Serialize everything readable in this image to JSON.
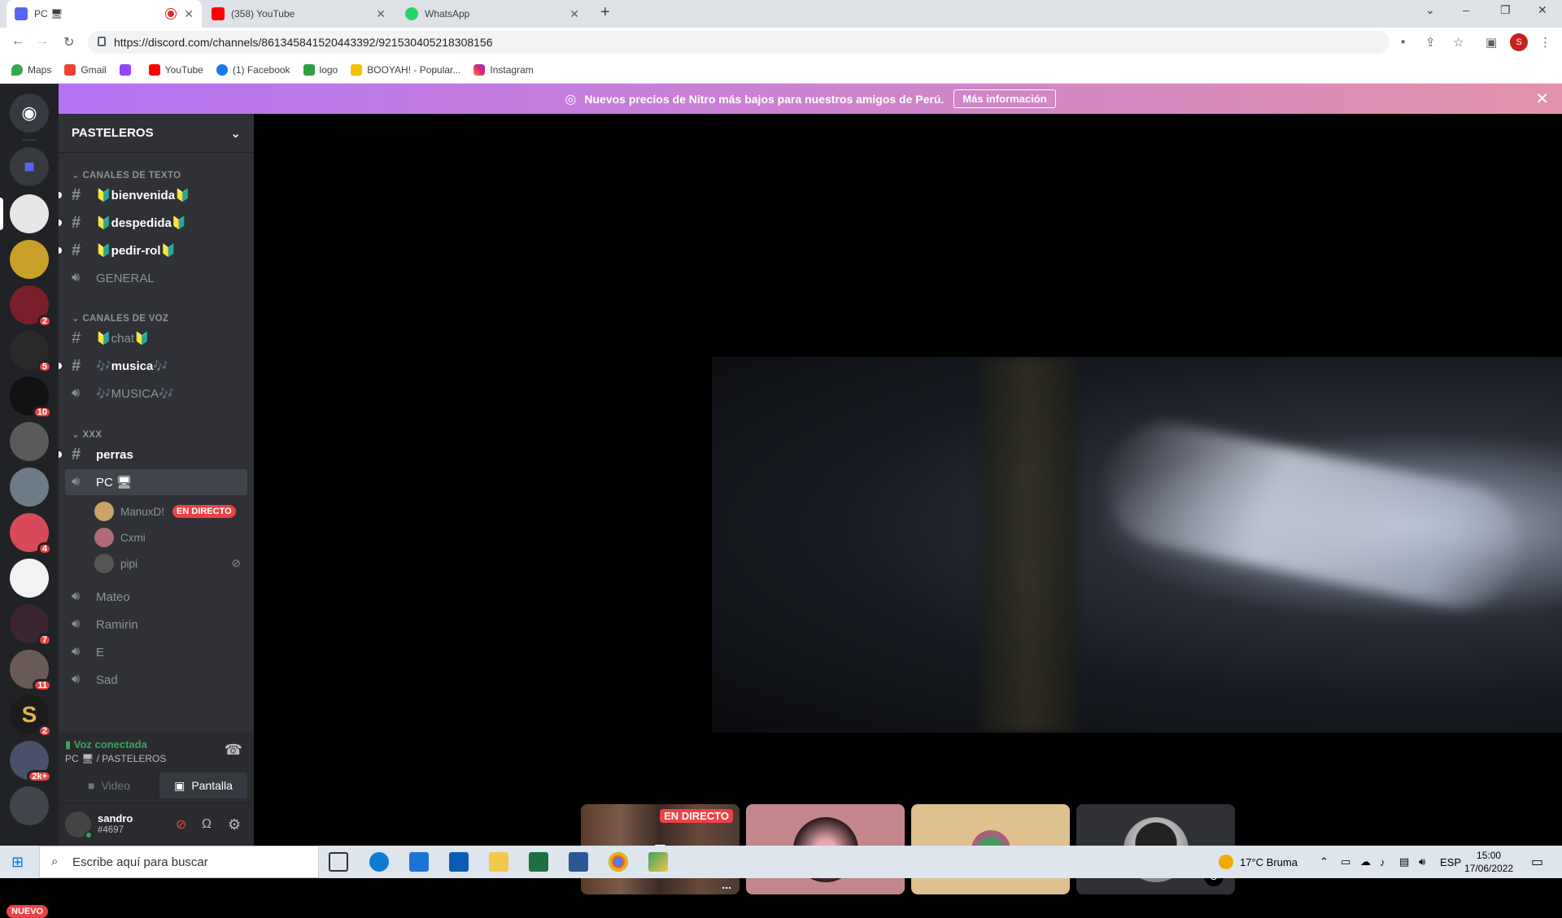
{
  "browser": {
    "tabs": [
      {
        "title": "PC 🖥",
        "active": true
      },
      {
        "title": "(358) YouTube"
      },
      {
        "title": "WhatsApp"
      }
    ],
    "new_tab": "+",
    "url": "https://discord.com/channels/861345841520443392/921530405218308156",
    "profile_initial": "S",
    "bookmarks": [
      "Maps",
      "Gmail",
      "",
      "YouTube",
      "(1) Facebook",
      "logo",
      "BOOYAH! - Popular...",
      "Instagram"
    ],
    "window_controls": [
      "⌄",
      "–",
      "❐",
      "✕"
    ]
  },
  "banner": {
    "text": "Nuevos precios de Nitro más bajos para nuestros amigos de Perú.",
    "button": "Más información"
  },
  "guild_badges": [
    "2",
    "5",
    "10",
    "4",
    "7",
    "11",
    "2",
    "2k+"
  ],
  "guild_new": "NUEVO",
  "server": {
    "name": "PASTELEROS"
  },
  "categories": [
    "CANALES DE TEXTO",
    "CANALES DE VOZ",
    "XXX"
  ],
  "channels": {
    "text": [
      "🔰bienvenida🔰",
      "🔰despedida🔰",
      "🔰pedir-rol🔰",
      "GENERAL"
    ],
    "voice": [
      "🔰chat🔰",
      "🎶musica🎶",
      "🎶MUSICA🎶"
    ],
    "xxx": [
      "perras",
      "PC 🖥",
      "Mateo",
      "Ramirin",
      "E",
      "Sad"
    ]
  },
  "voice_users": [
    {
      "name": "ManuxD!",
      "live": "EN DIRECTO"
    },
    {
      "name": "Cxmi"
    },
    {
      "name": "pipi"
    }
  ],
  "voice_connected": {
    "status": "Voz conectada",
    "location": "PC 🖥 / PASTELEROS",
    "video": "Video",
    "screen": "Pantalla"
  },
  "user": {
    "name": "sandro",
    "tag": "#4697"
  },
  "tiles": {
    "live_label": "EN DIRECTO",
    "more": "..."
  },
  "taskbar": {
    "search_placeholder": "Escribe aquí para buscar",
    "weather": "17°C  Bruma",
    "lang": "ESP",
    "time": "15:00",
    "date": "17/06/2022"
  },
  "colors": {
    "blurple": "#5865f2",
    "red": "#ed4245",
    "green": "#3ba55d"
  }
}
